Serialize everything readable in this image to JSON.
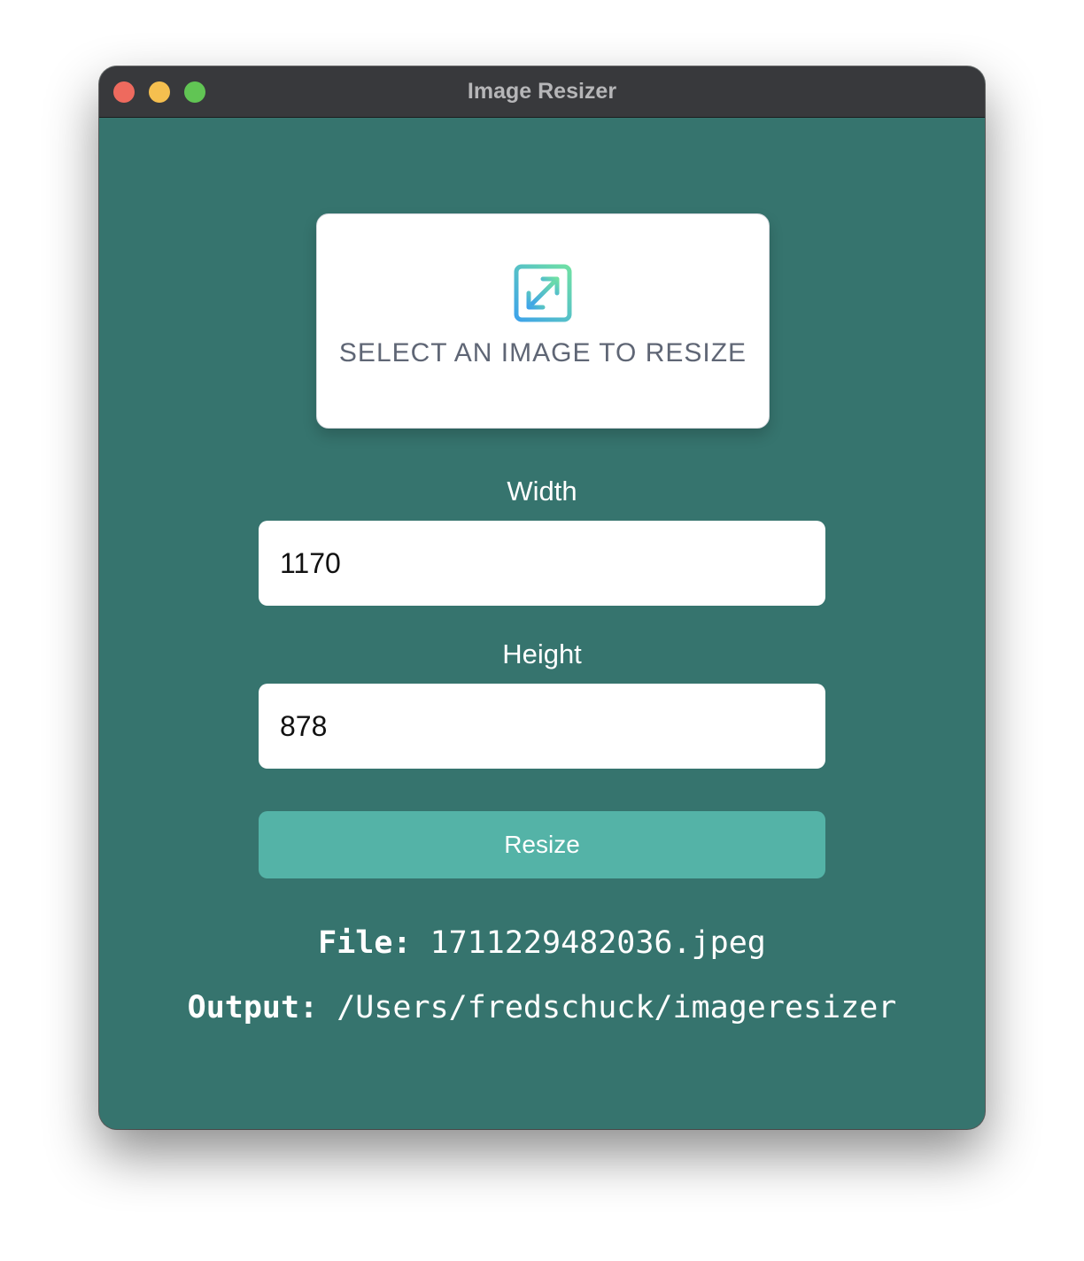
{
  "window": {
    "title": "Image Resizer",
    "controls": {
      "close_color": "#ee6a5e",
      "minimize_color": "#f5bf4f",
      "maximize_color": "#61c554"
    }
  },
  "dropzone": {
    "icon": "expand-arrows-icon",
    "label": "SELECT AN IMAGE TO RESIZE"
  },
  "form": {
    "width_label": "Width",
    "width_value": "1170",
    "height_label": "Height",
    "height_value": "878",
    "resize_label": "Resize"
  },
  "info": {
    "file_key": "File:",
    "file_value": "1711229482036.jpeg",
    "output_key": "Output:",
    "output_value": "/Users/fredschuck/imageresizer"
  },
  "colors": {
    "background": "#36746e",
    "titlebar": "#38393c",
    "button": "#54b3a7"
  }
}
